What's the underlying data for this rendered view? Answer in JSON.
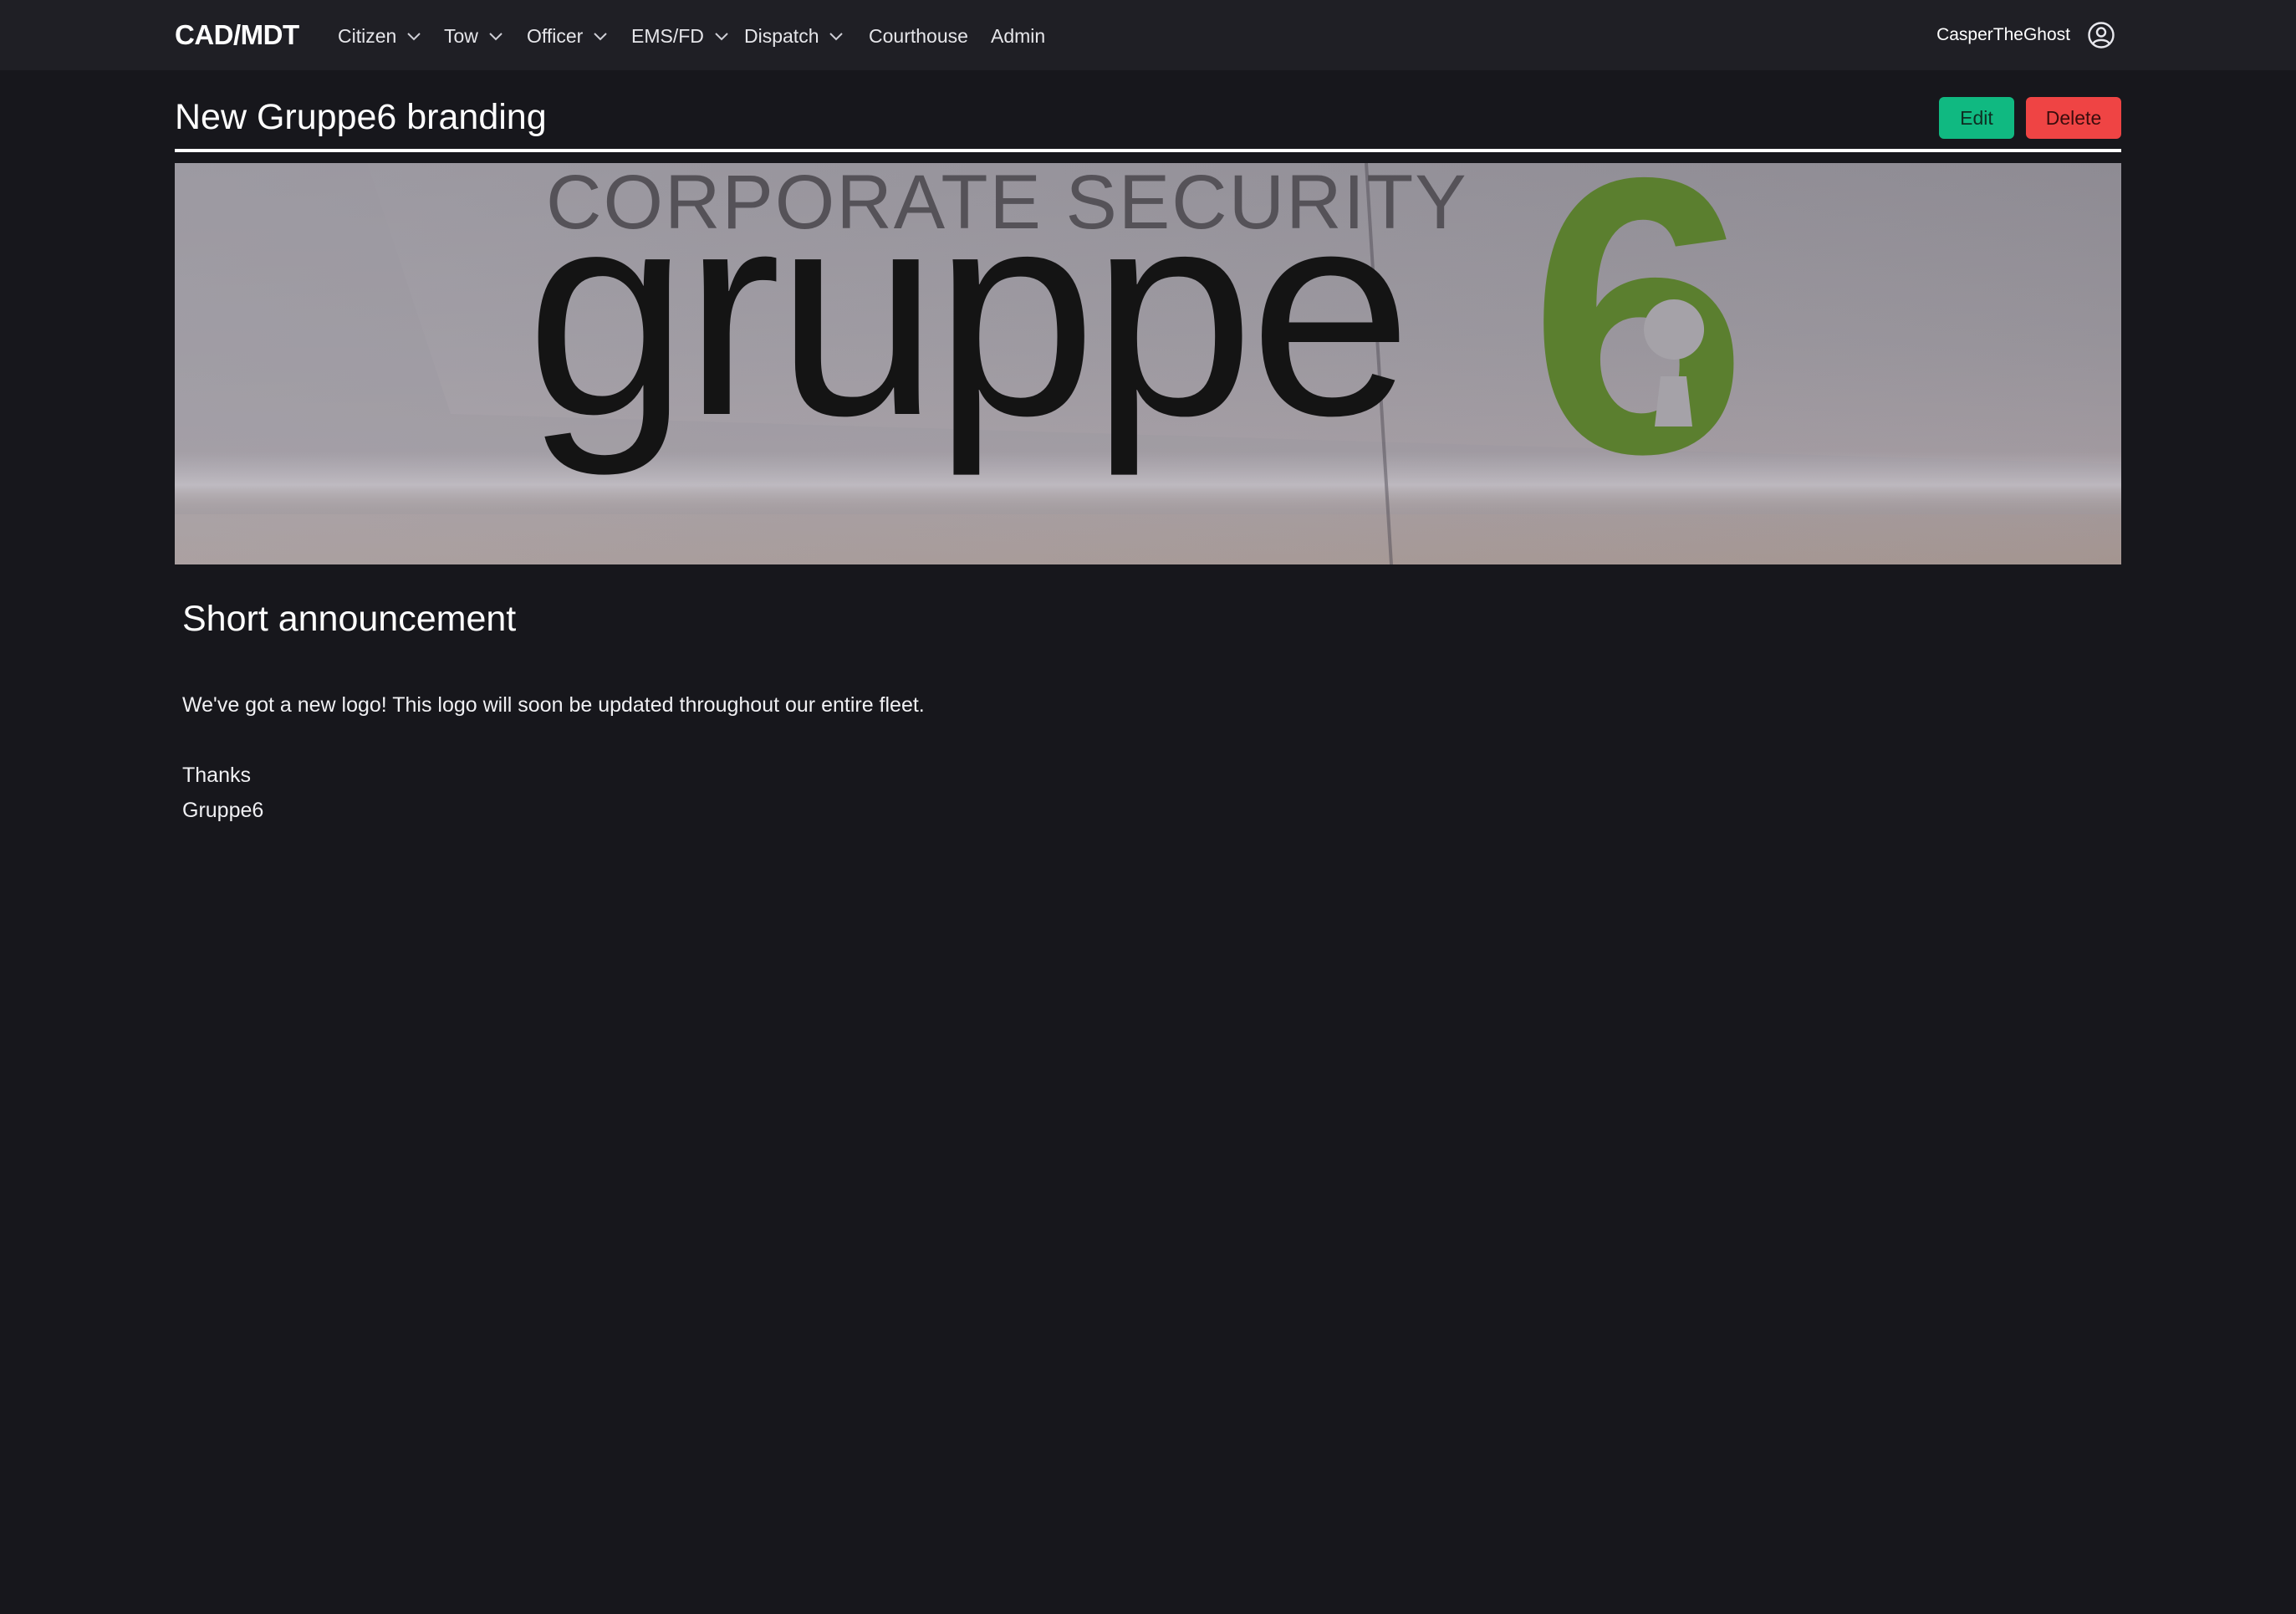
{
  "nav": {
    "brand": "CAD/MDT",
    "items": [
      {
        "label": "Citizen",
        "dropdown": true
      },
      {
        "label": "Tow",
        "dropdown": true
      },
      {
        "label": "Officer",
        "dropdown": true
      },
      {
        "label": "EMS/FD",
        "dropdown": true
      },
      {
        "label": "Dispatch",
        "dropdown": true
      },
      {
        "label": "Courthouse",
        "dropdown": false
      },
      {
        "label": "Admin",
        "dropdown": false
      }
    ],
    "username": "CasperTheGhost",
    "user_icon": "user-circle-icon"
  },
  "page": {
    "title": "New Gruppe6 branding",
    "edit_label": "Edit",
    "delete_label": "Delete"
  },
  "banner": {
    "top_text": "CORPORATE SECURITY",
    "logo_word": "gruppe",
    "logo_mark": "6"
  },
  "content": {
    "heading": "Short announcement",
    "paragraph": "We've got a new logo! This logo will soon be updated throughout our entire fleet.",
    "closing": "Thanks",
    "signature": "Gruppe6"
  },
  "colors": {
    "background": "#17171c",
    "navbar": "#1f1f25",
    "edit_button": "#10b981",
    "delete_button": "#ef4444",
    "logo_green": "#5b7f2f"
  }
}
